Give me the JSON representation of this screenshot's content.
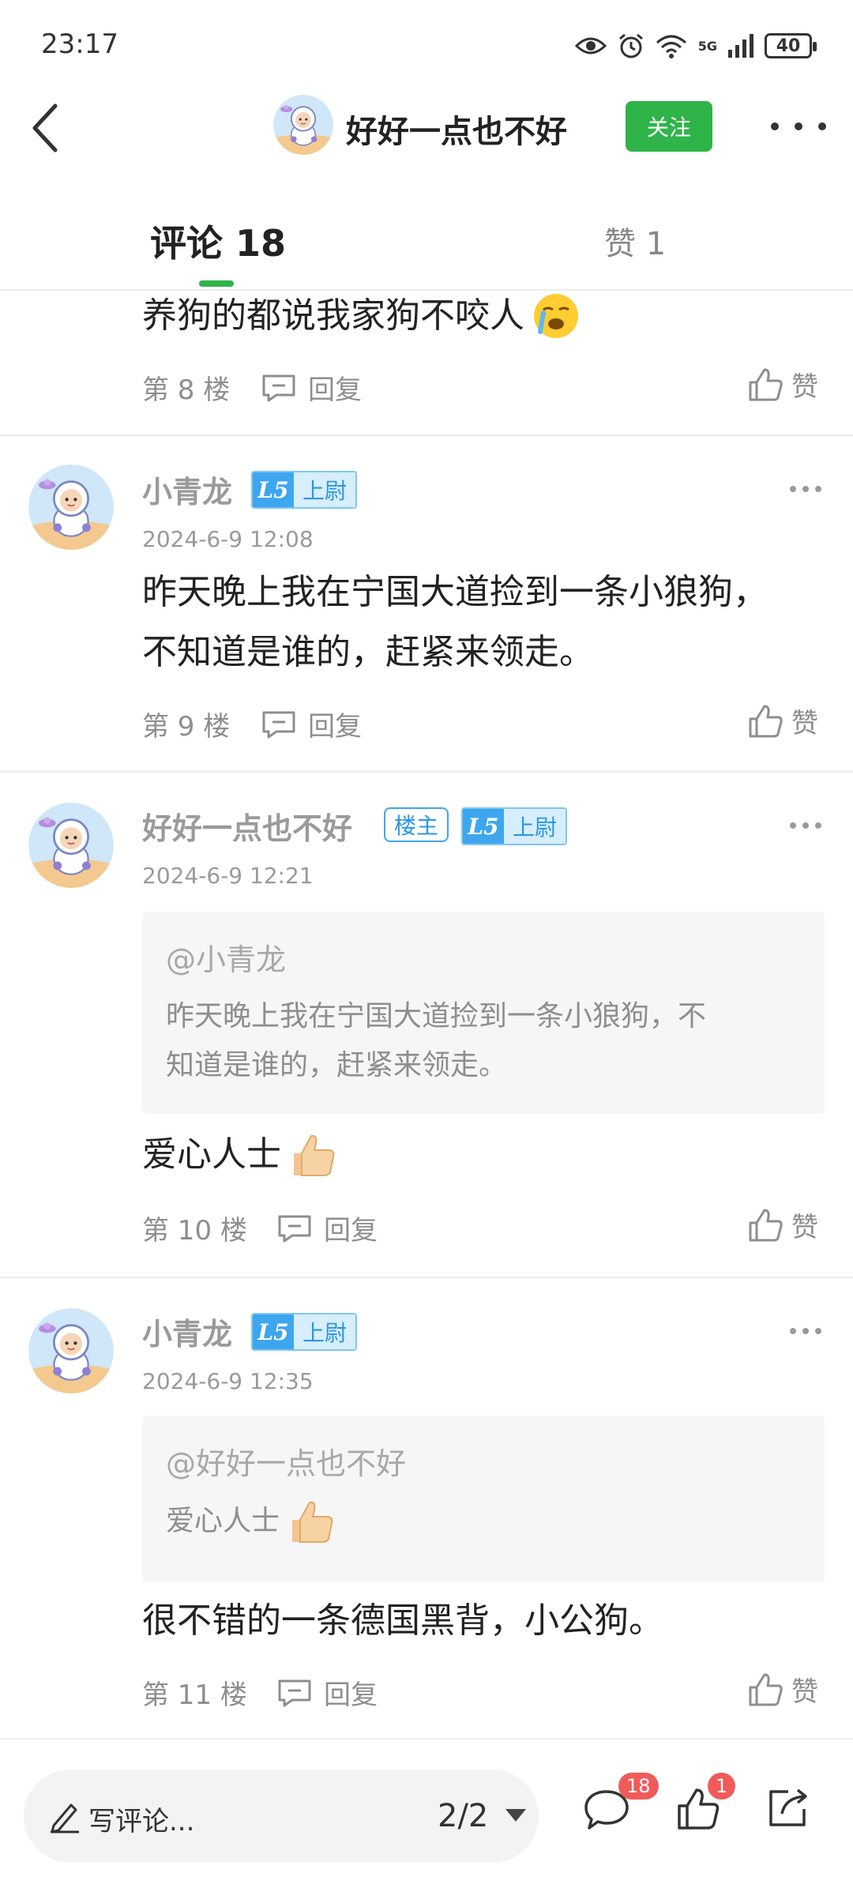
{
  "status_bar": {
    "time": "23:17",
    "network": "5G",
    "battery": "40"
  },
  "header": {
    "title": "好好一点也不好",
    "follow_label": "关注"
  },
  "tabs": {
    "comments_label": "评论 18",
    "likes_label": "赞 1"
  },
  "comments": [
    {
      "content": "养狗的都说我家狗不咬人",
      "floor": "第 8 楼",
      "reply_label": "回复",
      "like_label": "赞"
    },
    {
      "username": "小青龙",
      "level": "L5",
      "rank": "上尉",
      "date": "2024-6-9 12:08",
      "content_line1": "昨天晚上我在宁国大道捡到一条小狼狗，",
      "content_line2": "不知道是谁的，赶紧来领走。",
      "floor": "第 9 楼",
      "reply_label": "回复",
      "like_label": "赞"
    },
    {
      "username": "好好一点也不好",
      "owner_label": "楼主",
      "level": "L5",
      "rank": "上尉",
      "date": "2024-6-9 12:21",
      "quote_at": "@小青龙",
      "quote_line1": "昨天晚上我在宁国大道捡到一条小狼狗，不",
      "quote_line2": "知道是谁的，赶紧来领走。",
      "content": "爱心人士",
      "floor": "第 10 楼",
      "reply_label": "回复",
      "like_label": "赞"
    },
    {
      "username": "小青龙",
      "level": "L5",
      "rank": "上尉",
      "date": "2024-6-9 12:35",
      "quote_at": "@好好一点也不好",
      "quote_text": "爱心人士",
      "content": "很不错的一条德国黑背，小公狗。",
      "floor": "第 11 楼",
      "reply_label": "回复",
      "like_label": "赞"
    }
  ],
  "bottom_bar": {
    "write_placeholder": "写评论...",
    "page_indicator": "2/2",
    "comment_count": "18",
    "like_count": "1"
  },
  "colors": {
    "accent": "#2fb44a",
    "level_blue": "#3ea6ef",
    "badge_red": "#f15a5a"
  }
}
